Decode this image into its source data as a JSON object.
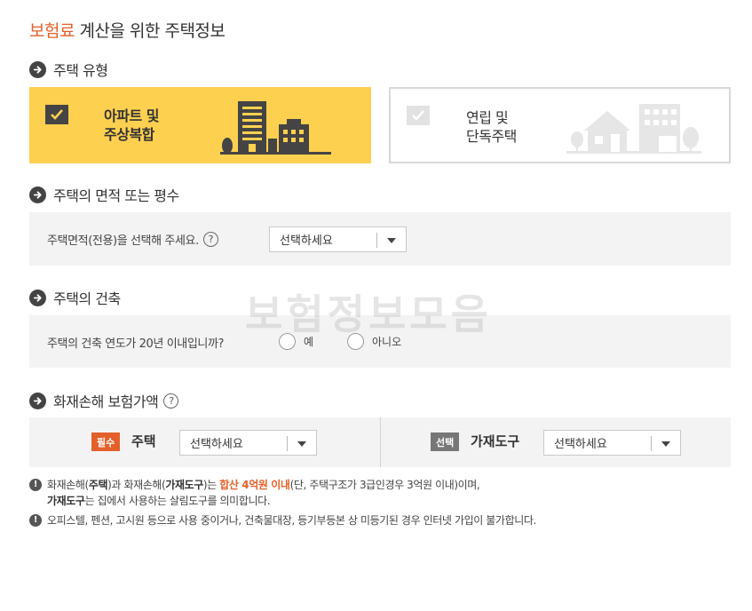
{
  "page": {
    "title_accent": "보험료",
    "title_rest": " 계산을 위한 주택정보"
  },
  "house_type": {
    "heading": "주택 유형",
    "options": [
      {
        "line1": "아파트 및",
        "line2": "주상복합",
        "selected": true
      },
      {
        "line1": "연립 및",
        "line2": "단독주택",
        "selected": false
      }
    ]
  },
  "area": {
    "heading": "주택의 면적 또는 평수",
    "prompt": "주택면적(전용)을 선택해 주세요.",
    "help_symbol": "?",
    "select_value": "선택하세요"
  },
  "construction": {
    "heading": "주택의 건축",
    "question": "주택의 건축 연도가 20년 이내입니까?",
    "options": [
      "예",
      "아니오"
    ]
  },
  "insured_value": {
    "heading": "화재손해 보험가액",
    "help_symbol": "?",
    "house": {
      "badge": "필수",
      "label": "주택",
      "select_value": "선택하세요"
    },
    "goods": {
      "badge": "선택",
      "label": "가재도구",
      "select_value": "선택하세요"
    }
  },
  "notices": {
    "n1": {
      "p1": "화재손해(",
      "b1": "주택",
      "p2": ")과 화재손해(",
      "b2": "가재도구",
      "p3": ")는 ",
      "hl": "합산 4억원 이내",
      "p4": "(단, 주택구조가 3급인경우 3억원 이내)이며,",
      "b3": "가재도구",
      "p5": "는 집에서 사용하는 살림도구를 의미합니다."
    },
    "n2": "오피스텔, 펜션, 고시원 등으로 사용 중이거나, 건축물대장, 등기부등본 상 미등기된 경우 인터넷 가입이 불가합니다."
  },
  "watermark": "보험정보모음",
  "colors": {
    "accent": "#e4602a",
    "selected_card": "#fdd04f",
    "row_bg": "#f3f3f3"
  },
  "icons": [
    "arrow-right-icon",
    "checkmark-icon",
    "help-icon",
    "apartment-illustration",
    "house-illustration",
    "exclamation-icon"
  ]
}
